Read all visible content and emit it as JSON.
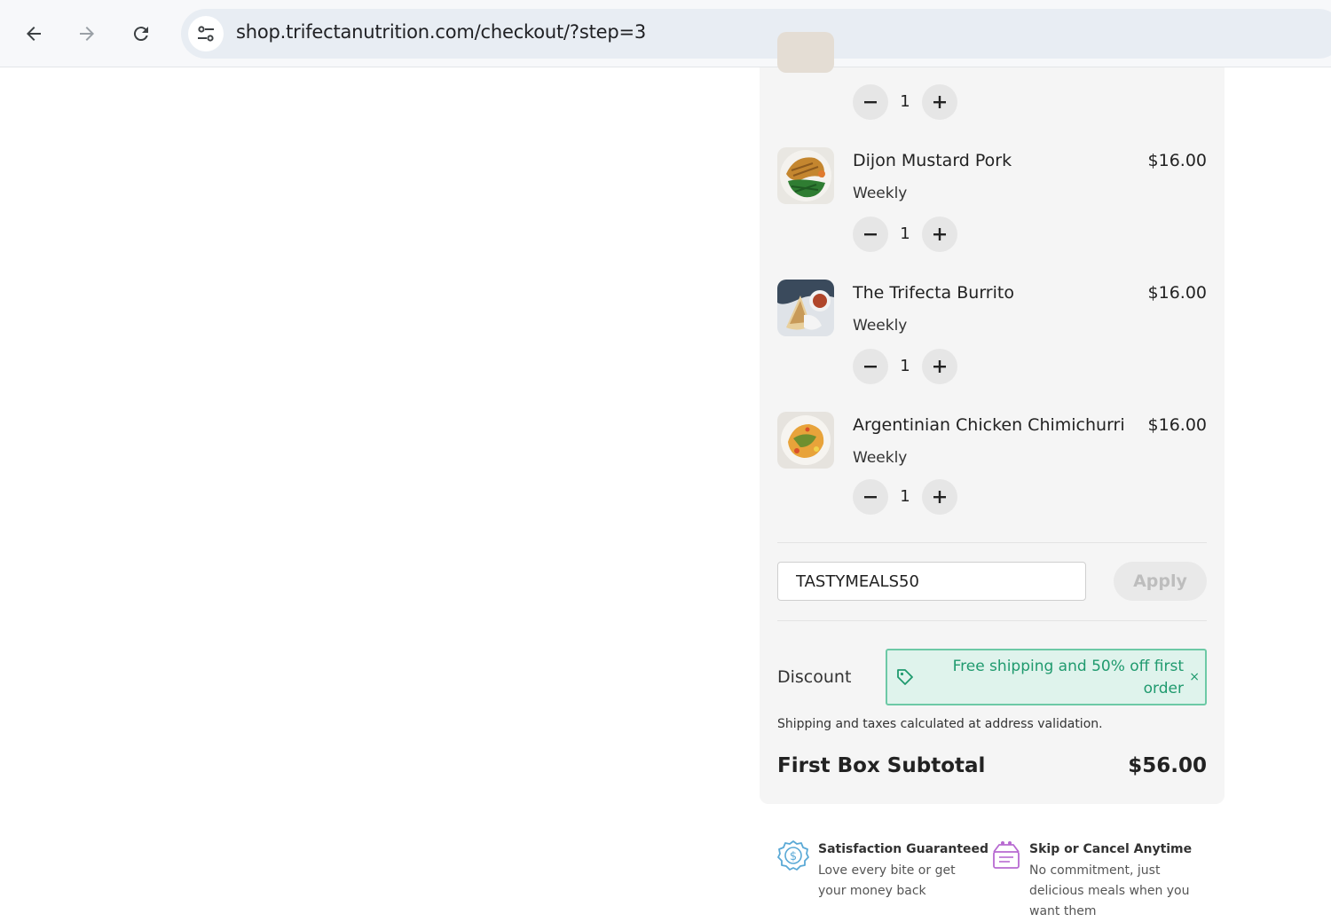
{
  "browser": {
    "url": "shop.trifectanutrition.com/checkout/?step=3"
  },
  "cart": {
    "items": [
      {
        "name": "Dijon Mustard Pork",
        "price": "$16.00",
        "plan": "Weekly",
        "quantity": "1"
      },
      {
        "name": "The Trifecta Burrito",
        "price": "$16.00",
        "plan": "Weekly",
        "quantity": "1"
      },
      {
        "name": "Argentinian Chicken Chimichurri",
        "price": "$16.00",
        "plan": "Weekly",
        "quantity": "1"
      }
    ],
    "partial_item_quantity": "1",
    "promo_code_value": "TASTYMEALS50",
    "apply_label": "Apply",
    "discount_label": "Discount",
    "discount_text": "Free shipping and 50% off first order",
    "discount_close": "×",
    "shipping_note": "Shipping and taxes calculated at address validation.",
    "subtotal_label": "First Box Subtotal",
    "subtotal_value": "$56.00"
  },
  "guarantees": [
    {
      "title": "Satisfaction Guaranteed",
      "description": "Love every bite or get your money back",
      "icon": "badge-dollar-icon",
      "color": "#5aa9d6"
    },
    {
      "title": "Skip or Cancel Anytime",
      "description": "No commitment, just delicious meals when you want them",
      "icon": "meal-box-icon",
      "color": "#b76ad1"
    }
  ],
  "colors": {
    "discount_green": "#1f9a6e",
    "discount_bg": "#dff3ec",
    "panel_bg": "#f5f5f5"
  }
}
